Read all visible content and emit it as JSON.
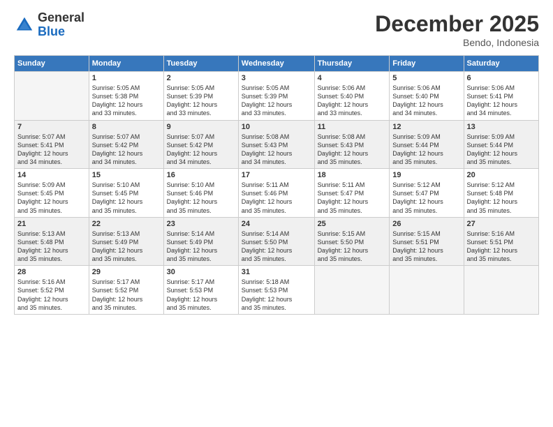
{
  "logo": {
    "general": "General",
    "blue": "Blue"
  },
  "title": "December 2025",
  "location": "Bendo, Indonesia",
  "weekdays": [
    "Sunday",
    "Monday",
    "Tuesday",
    "Wednesday",
    "Thursday",
    "Friday",
    "Saturday"
  ],
  "weeks": [
    [
      {
        "day": "",
        "sunrise": "",
        "sunset": "",
        "daylight": "",
        "empty": true
      },
      {
        "day": "1",
        "sunrise": "Sunrise: 5:05 AM",
        "sunset": "Sunset: 5:38 PM",
        "daylight": "Daylight: 12 hours and 33 minutes."
      },
      {
        "day": "2",
        "sunrise": "Sunrise: 5:05 AM",
        "sunset": "Sunset: 5:39 PM",
        "daylight": "Daylight: 12 hours and 33 minutes."
      },
      {
        "day": "3",
        "sunrise": "Sunrise: 5:05 AM",
        "sunset": "Sunset: 5:39 PM",
        "daylight": "Daylight: 12 hours and 33 minutes."
      },
      {
        "day": "4",
        "sunrise": "Sunrise: 5:06 AM",
        "sunset": "Sunset: 5:40 PM",
        "daylight": "Daylight: 12 hours and 33 minutes."
      },
      {
        "day": "5",
        "sunrise": "Sunrise: 5:06 AM",
        "sunset": "Sunset: 5:40 PM",
        "daylight": "Daylight: 12 hours and 34 minutes."
      },
      {
        "day": "6",
        "sunrise": "Sunrise: 5:06 AM",
        "sunset": "Sunset: 5:41 PM",
        "daylight": "Daylight: 12 hours and 34 minutes."
      }
    ],
    [
      {
        "day": "7",
        "sunrise": "Sunrise: 5:07 AM",
        "sunset": "Sunset: 5:41 PM",
        "daylight": "Daylight: 12 hours and 34 minutes."
      },
      {
        "day": "8",
        "sunrise": "Sunrise: 5:07 AM",
        "sunset": "Sunset: 5:42 PM",
        "daylight": "Daylight: 12 hours and 34 minutes."
      },
      {
        "day": "9",
        "sunrise": "Sunrise: 5:07 AM",
        "sunset": "Sunset: 5:42 PM",
        "daylight": "Daylight: 12 hours and 34 minutes."
      },
      {
        "day": "10",
        "sunrise": "Sunrise: 5:08 AM",
        "sunset": "Sunset: 5:43 PM",
        "daylight": "Daylight: 12 hours and 34 minutes."
      },
      {
        "day": "11",
        "sunrise": "Sunrise: 5:08 AM",
        "sunset": "Sunset: 5:43 PM",
        "daylight": "Daylight: 12 hours and 35 minutes."
      },
      {
        "day": "12",
        "sunrise": "Sunrise: 5:09 AM",
        "sunset": "Sunset: 5:44 PM",
        "daylight": "Daylight: 12 hours and 35 minutes."
      },
      {
        "day": "13",
        "sunrise": "Sunrise: 5:09 AM",
        "sunset": "Sunset: 5:44 PM",
        "daylight": "Daylight: 12 hours and 35 minutes."
      }
    ],
    [
      {
        "day": "14",
        "sunrise": "Sunrise: 5:09 AM",
        "sunset": "Sunset: 5:45 PM",
        "daylight": "Daylight: 12 hours and 35 minutes."
      },
      {
        "day": "15",
        "sunrise": "Sunrise: 5:10 AM",
        "sunset": "Sunset: 5:45 PM",
        "daylight": "Daylight: 12 hours and 35 minutes."
      },
      {
        "day": "16",
        "sunrise": "Sunrise: 5:10 AM",
        "sunset": "Sunset: 5:46 PM",
        "daylight": "Daylight: 12 hours and 35 minutes."
      },
      {
        "day": "17",
        "sunrise": "Sunrise: 5:11 AM",
        "sunset": "Sunset: 5:46 PM",
        "daylight": "Daylight: 12 hours and 35 minutes."
      },
      {
        "day": "18",
        "sunrise": "Sunrise: 5:11 AM",
        "sunset": "Sunset: 5:47 PM",
        "daylight": "Daylight: 12 hours and 35 minutes."
      },
      {
        "day": "19",
        "sunrise": "Sunrise: 5:12 AM",
        "sunset": "Sunset: 5:47 PM",
        "daylight": "Daylight: 12 hours and 35 minutes."
      },
      {
        "day": "20",
        "sunrise": "Sunrise: 5:12 AM",
        "sunset": "Sunset: 5:48 PM",
        "daylight": "Daylight: 12 hours and 35 minutes."
      }
    ],
    [
      {
        "day": "21",
        "sunrise": "Sunrise: 5:13 AM",
        "sunset": "Sunset: 5:48 PM",
        "daylight": "Daylight: 12 hours and 35 minutes."
      },
      {
        "day": "22",
        "sunrise": "Sunrise: 5:13 AM",
        "sunset": "Sunset: 5:49 PM",
        "daylight": "Daylight: 12 hours and 35 minutes."
      },
      {
        "day": "23",
        "sunrise": "Sunrise: 5:14 AM",
        "sunset": "Sunset: 5:49 PM",
        "daylight": "Daylight: 12 hours and 35 minutes."
      },
      {
        "day": "24",
        "sunrise": "Sunrise: 5:14 AM",
        "sunset": "Sunset: 5:50 PM",
        "daylight": "Daylight: 12 hours and 35 minutes."
      },
      {
        "day": "25",
        "sunrise": "Sunrise: 5:15 AM",
        "sunset": "Sunset: 5:50 PM",
        "daylight": "Daylight: 12 hours and 35 minutes."
      },
      {
        "day": "26",
        "sunrise": "Sunrise: 5:15 AM",
        "sunset": "Sunset: 5:51 PM",
        "daylight": "Daylight: 12 hours and 35 minutes."
      },
      {
        "day": "27",
        "sunrise": "Sunrise: 5:16 AM",
        "sunset": "Sunset: 5:51 PM",
        "daylight": "Daylight: 12 hours and 35 minutes."
      }
    ],
    [
      {
        "day": "28",
        "sunrise": "Sunrise: 5:16 AM",
        "sunset": "Sunset: 5:52 PM",
        "daylight": "Daylight: 12 hours and 35 minutes."
      },
      {
        "day": "29",
        "sunrise": "Sunrise: 5:17 AM",
        "sunset": "Sunset: 5:52 PM",
        "daylight": "Daylight: 12 hours and 35 minutes."
      },
      {
        "day": "30",
        "sunrise": "Sunrise: 5:17 AM",
        "sunset": "Sunset: 5:53 PM",
        "daylight": "Daylight: 12 hours and 35 minutes."
      },
      {
        "day": "31",
        "sunrise": "Sunrise: 5:18 AM",
        "sunset": "Sunset: 5:53 PM",
        "daylight": "Daylight: 12 hours and 35 minutes."
      },
      {
        "day": "",
        "sunrise": "",
        "sunset": "",
        "daylight": "",
        "empty": true
      },
      {
        "day": "",
        "sunrise": "",
        "sunset": "",
        "daylight": "",
        "empty": true
      },
      {
        "day": "",
        "sunrise": "",
        "sunset": "",
        "daylight": "",
        "empty": true
      }
    ]
  ]
}
